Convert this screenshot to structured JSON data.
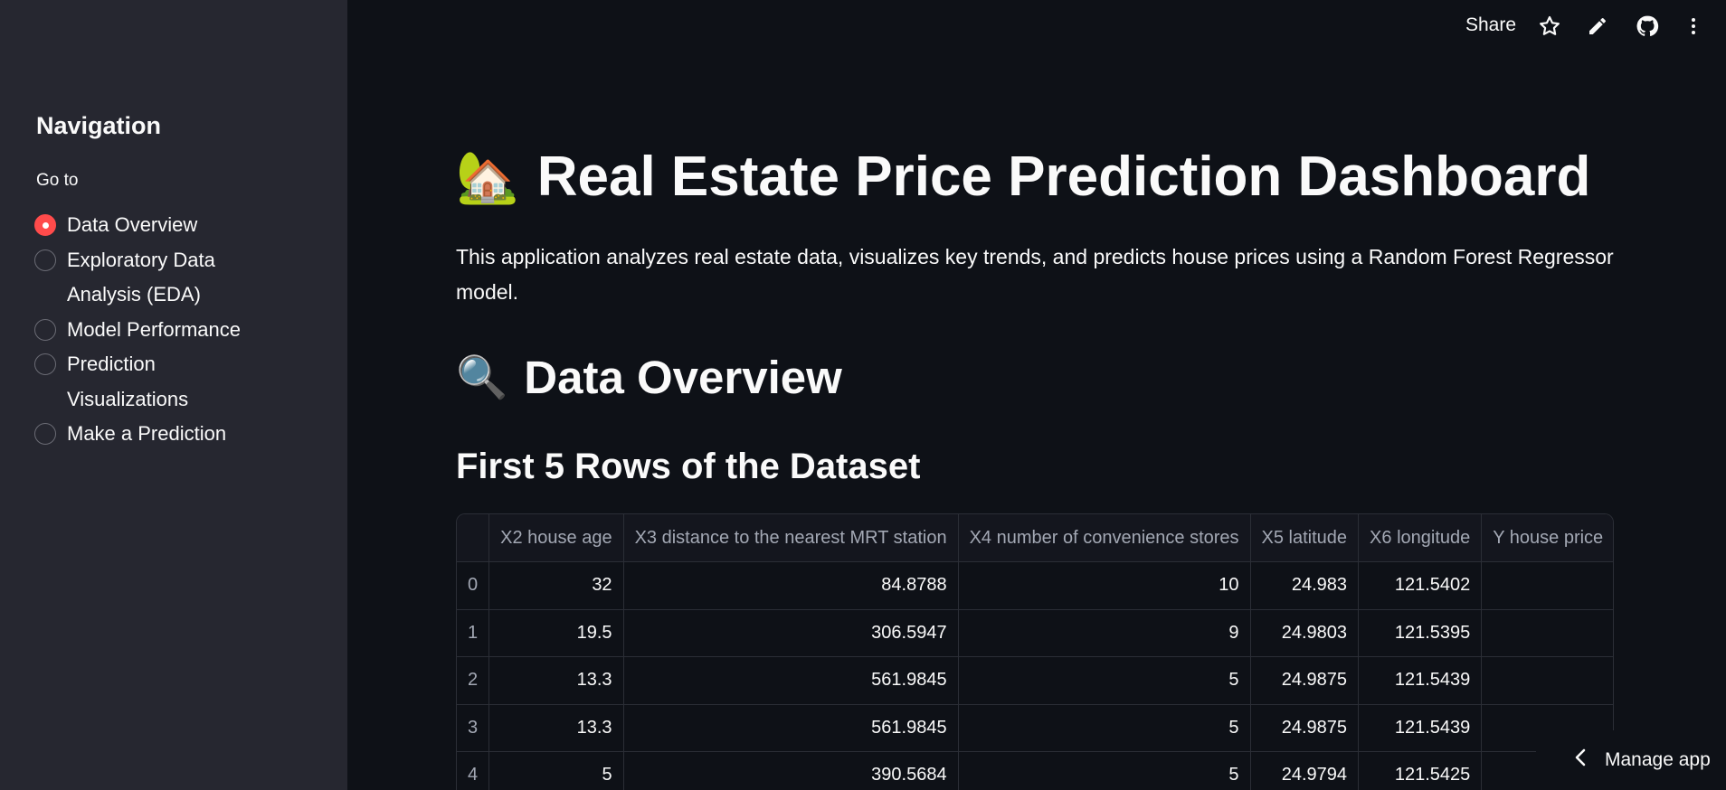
{
  "topbar": {
    "share_label": "Share",
    "icons": [
      "star-icon",
      "pencil-icon",
      "github-icon",
      "more-icon"
    ]
  },
  "sidebar": {
    "title": "Navigation",
    "radio_label": "Go to",
    "items": [
      {
        "label": "Data Overview",
        "selected": true
      },
      {
        "label": "Exploratory Data Analysis (EDA)",
        "selected": false
      },
      {
        "label": "Model Performance",
        "selected": false
      },
      {
        "label": "Prediction Visualizations",
        "selected": false
      },
      {
        "label": "Make a Prediction",
        "selected": false
      }
    ]
  },
  "main": {
    "title_emoji": "🏡",
    "title": "Real Estate Price Prediction Dashboard",
    "intro": "This application analyzes real estate data, visualizes key trends, and predicts house prices using a Random Forest Regressor model.",
    "section_emoji": "🔍",
    "section_title": "Data Overview",
    "table_title": "First 5 Rows of the Dataset",
    "table": {
      "columns": [
        "",
        "X2 house age",
        "X3 distance to the nearest MRT station",
        "X4 number of convenience stores",
        "X5 latitude",
        "X6 longitude",
        "Y house price"
      ],
      "rows": [
        [
          "0",
          "32",
          "84.8788",
          "10",
          "24.983",
          "121.5402",
          ""
        ],
        [
          "1",
          "19.5",
          "306.5947",
          "9",
          "24.9803",
          "121.5395",
          ""
        ],
        [
          "2",
          "13.3",
          "561.9845",
          "5",
          "24.9875",
          "121.5439",
          ""
        ],
        [
          "3",
          "13.3",
          "561.9845",
          "5",
          "24.9875",
          "121.5439",
          ""
        ],
        [
          "4",
          "5",
          "390.5684",
          "5",
          "24.9794",
          "121.5425",
          ""
        ]
      ]
    }
  },
  "footer": {
    "manage_label": "Manage app"
  },
  "colors": {
    "accent": "#ff4b4b",
    "sidebar_bg": "#262730",
    "main_bg": "#0e1117"
  }
}
